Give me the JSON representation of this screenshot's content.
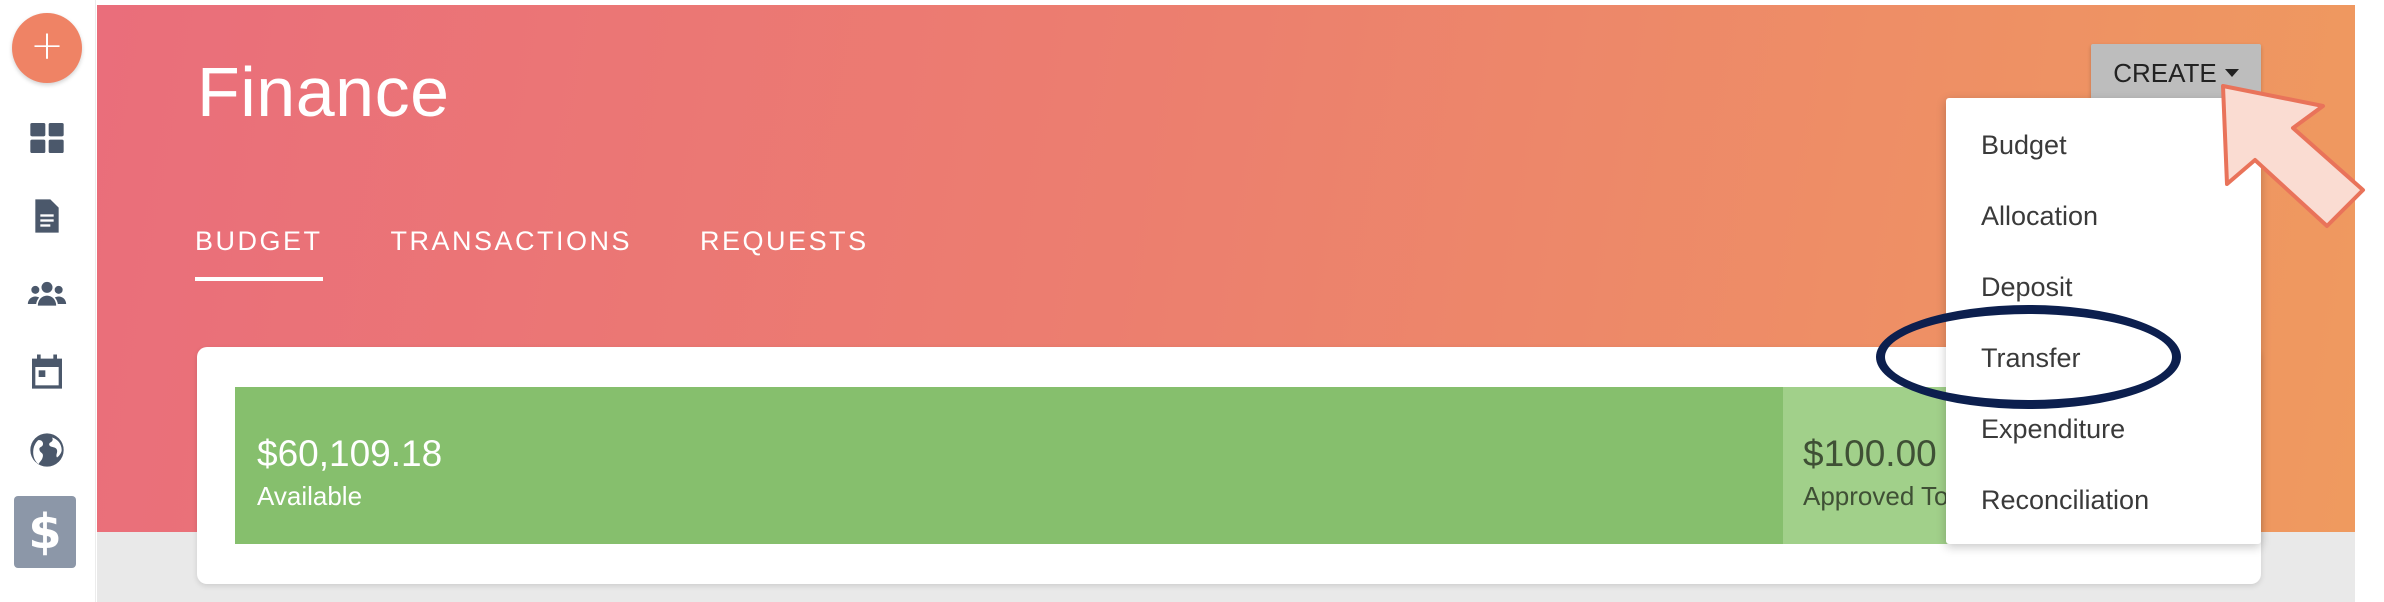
{
  "sidebar": {
    "fab_icon": "+",
    "items": [
      {
        "icon": "dashboard-icon"
      },
      {
        "icon": "document-icon"
      },
      {
        "icon": "users-icon"
      },
      {
        "icon": "calendar-icon"
      },
      {
        "icon": "globe-icon"
      },
      {
        "icon": "dollar-icon",
        "glyph": "$",
        "active": true
      }
    ]
  },
  "header": {
    "title": "Finance",
    "tabs": [
      {
        "label": "BUDGET",
        "active": true
      },
      {
        "label": "TRANSACTIONS"
      },
      {
        "label": "REQUESTS"
      }
    ]
  },
  "budget_bar": {
    "available_amount": "$60,109.18",
    "available_label": "Available",
    "approved_amount": "$100.00",
    "approved_label": "Approved To"
  },
  "create_button": {
    "label": "CREATE"
  },
  "create_menu": {
    "items": [
      "Budget",
      "Allocation",
      "Deposit",
      "Transfer",
      "Expenditure",
      "Reconciliation"
    ]
  },
  "colors": {
    "hero_start": "#ea6e7b",
    "hero_end": "#ef9a5f",
    "available_bar": "#86bf6d",
    "approved_bar": "#a1d08a",
    "highlight_ring": "#0c1f4e",
    "pointer_fill": "#fadcd2",
    "pointer_stroke": "#e9735a"
  }
}
